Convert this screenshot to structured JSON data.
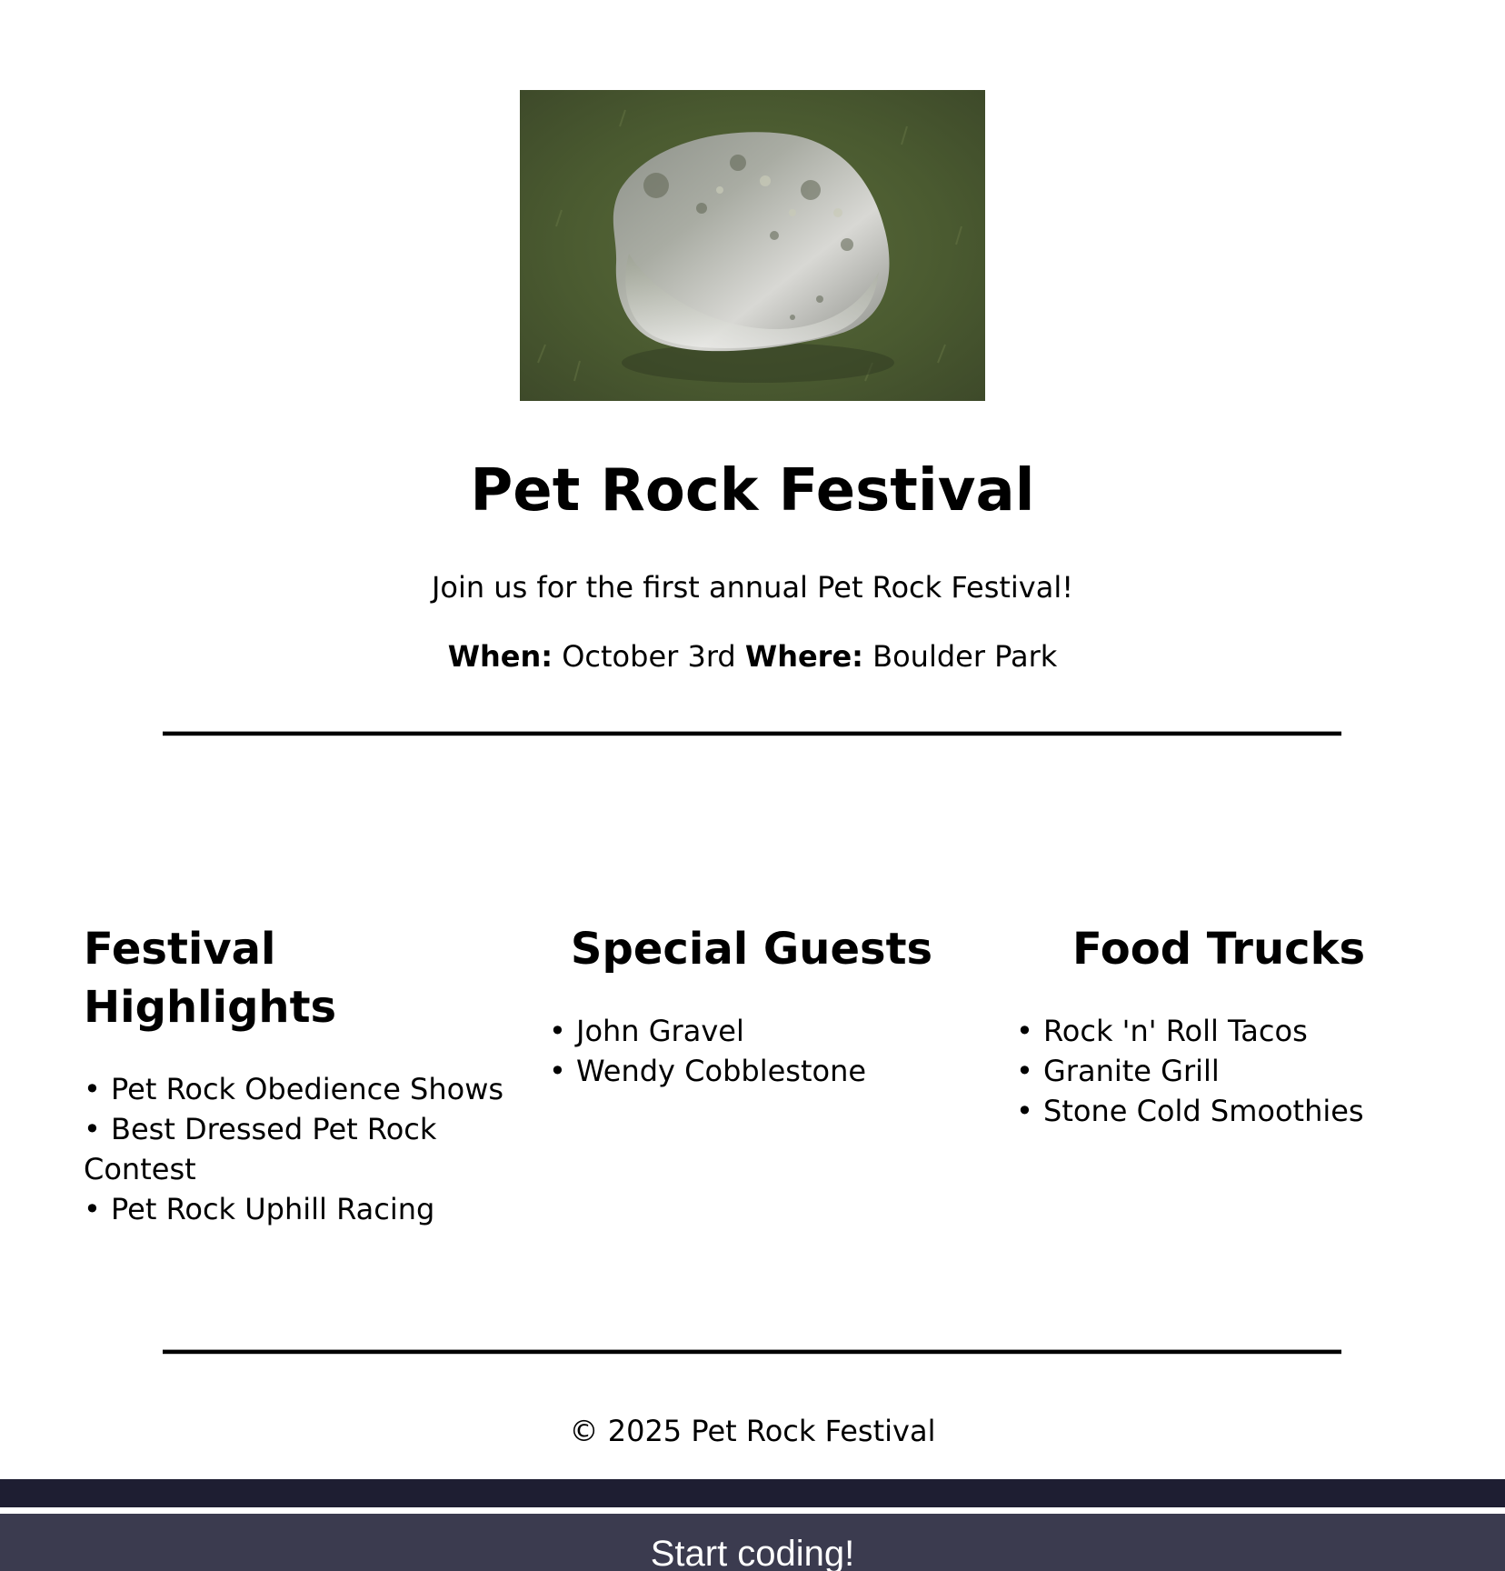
{
  "hero": {
    "image_alt": "pet rock on grass"
  },
  "title": "Pet Rock Festival",
  "intro": "Join us for the first annual Pet Rock Festival!",
  "details": {
    "when_label": "When:",
    "when_value": "October 3rd",
    "where_label": "Where:",
    "where_value": "Boulder Park"
  },
  "sections": {
    "highlights": {
      "heading": "Festival Highlights",
      "items": [
        "Pet Rock Obedience Shows",
        "Best Dressed Pet Rock Contest",
        "Pet Rock Uphill Racing"
      ]
    },
    "guests": {
      "heading": "Special Guests",
      "items": [
        "John Gravel",
        "Wendy Cobblestone"
      ]
    },
    "food": {
      "heading": "Food Trucks",
      "items": [
        "Rock 'n' Roll Tacos",
        "Granite Grill",
        "Stone Cold Smoothies"
      ]
    }
  },
  "footer": {
    "copyright": "© 2025 Pet Rock Festival"
  },
  "action_bar": {
    "label": "Start coding!"
  },
  "colors": {
    "dark_bar": "#1e1e32",
    "button_bar": "#3b3b4f"
  }
}
